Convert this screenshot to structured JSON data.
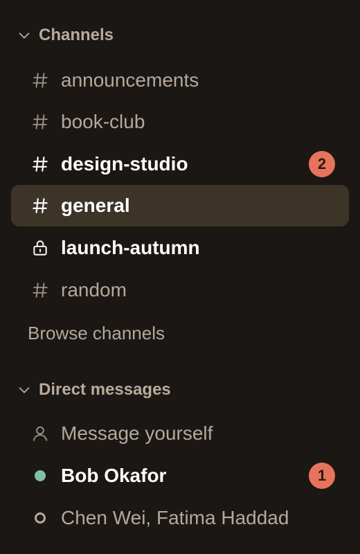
{
  "channels": {
    "header": "Channels",
    "items": [
      {
        "label": "announcements"
      },
      {
        "label": "book-club"
      },
      {
        "label": "design-studio",
        "badge": "2"
      },
      {
        "label": "general"
      },
      {
        "label": "launch-autumn"
      },
      {
        "label": "random"
      }
    ],
    "browse_label": "Browse channels"
  },
  "direct_messages": {
    "header": "Direct messages",
    "items": [
      {
        "label": "Message yourself"
      },
      {
        "label": "Bob Okafor",
        "badge": "1",
        "status": "online"
      },
      {
        "label": "Chen Wei, Fatima Haddad",
        "status": "offline"
      },
      {
        "label": "",
        "status": "away"
      }
    ]
  },
  "colors": {
    "background": "#1b1714",
    "selected_row": "#3d3428",
    "badge": "#e8735c",
    "online": "#7fbfa4"
  },
  "icons": [
    "chevron-down-icon",
    "hash-icon",
    "lock-icon",
    "user-icon",
    "status-dot-icon"
  ]
}
